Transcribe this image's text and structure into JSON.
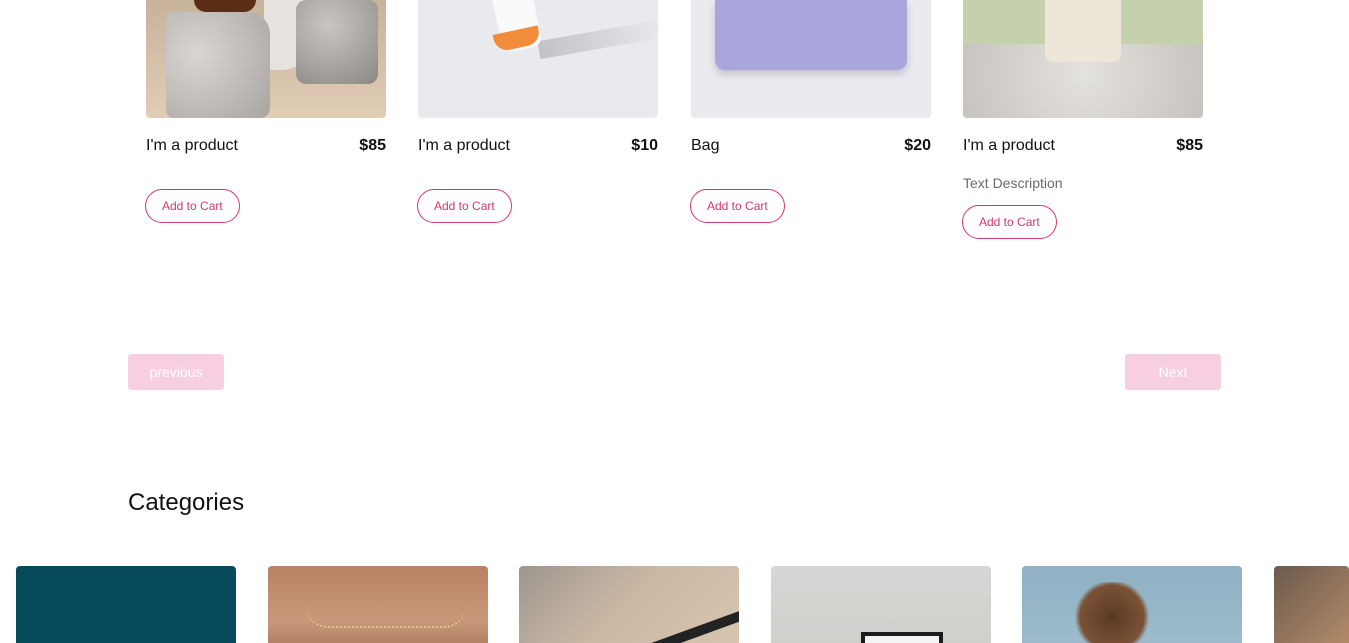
{
  "products": [
    {
      "name": "I'm a product",
      "price": "$85",
      "description": "",
      "button": "Add to Cart",
      "image": "stone-still-life"
    },
    {
      "name": "I'm a product",
      "price": "$10",
      "description": "",
      "button": "Add to Cart",
      "image": "cream-tube"
    },
    {
      "name": "Bag",
      "price": "$20",
      "description": "",
      "button": "Add to Cart",
      "image": "lavender-bag"
    },
    {
      "name": "I'm a product",
      "price": "$85",
      "description": "Text Description",
      "button": "Add to Cart",
      "image": "candle-on-stone"
    }
  ],
  "pagination": {
    "previous_label": "previous",
    "next_label": "Next"
  },
  "categories": {
    "title": "Categories",
    "items": [
      "teal-tile",
      "necklace",
      "hat",
      "picture-frame",
      "woman-hair",
      "portrait"
    ]
  },
  "colors": {
    "accent": "#d2386b",
    "pager_bg": "#f8cfe1",
    "text": "#111111",
    "muted": "#6b6b6b"
  }
}
